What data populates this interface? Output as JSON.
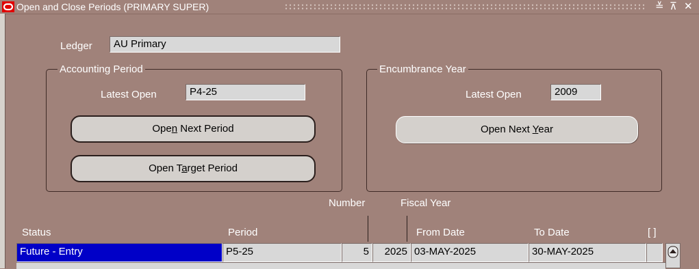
{
  "window": {
    "title": "Open and Close Periods (PRIMARY SUPER)",
    "controls": {
      "minimize": "≚",
      "maximize": "⊼",
      "close": "✕"
    }
  },
  "ledger": {
    "label": "Ledger",
    "value": "AU Primary"
  },
  "accounting_period": {
    "group_title": "Accounting Period",
    "latest_open_label": "Latest Open",
    "latest_open_value": "P4-25",
    "open_next_btn": {
      "pre": "Ope",
      "accel": "n",
      "post": " Next Period"
    },
    "open_target_btn": {
      "pre": "Open T",
      "accel": "a",
      "post": "rget Period"
    }
  },
  "encumbrance_year": {
    "group_title": "Encumbrance Year",
    "latest_open_label": "Latest Open",
    "latest_open_value": "2009",
    "open_next_btn": {
      "pre": "Open Next ",
      "accel": "Y",
      "post": "ear"
    }
  },
  "table": {
    "headers": {
      "status": "Status",
      "period": "Period",
      "number": "Number",
      "fiscal_year": "Fiscal Year",
      "from_date": "From Date",
      "to_date": "To Date",
      "flag": "[ ]"
    },
    "rows": [
      {
        "status": "Future - Entry",
        "period": "P5-25",
        "number": "5",
        "fiscal_year": "2025",
        "from_date": "03-MAY-2025",
        "to_date": "30-MAY-2025"
      }
    ]
  },
  "icons": {
    "app": "oracle-logo-icon",
    "scroll_up": "scroll-up-arrow-icon"
  },
  "colors": {
    "background": "#a0827a",
    "selection": "#0000c8",
    "field": "#d8d8d8"
  }
}
